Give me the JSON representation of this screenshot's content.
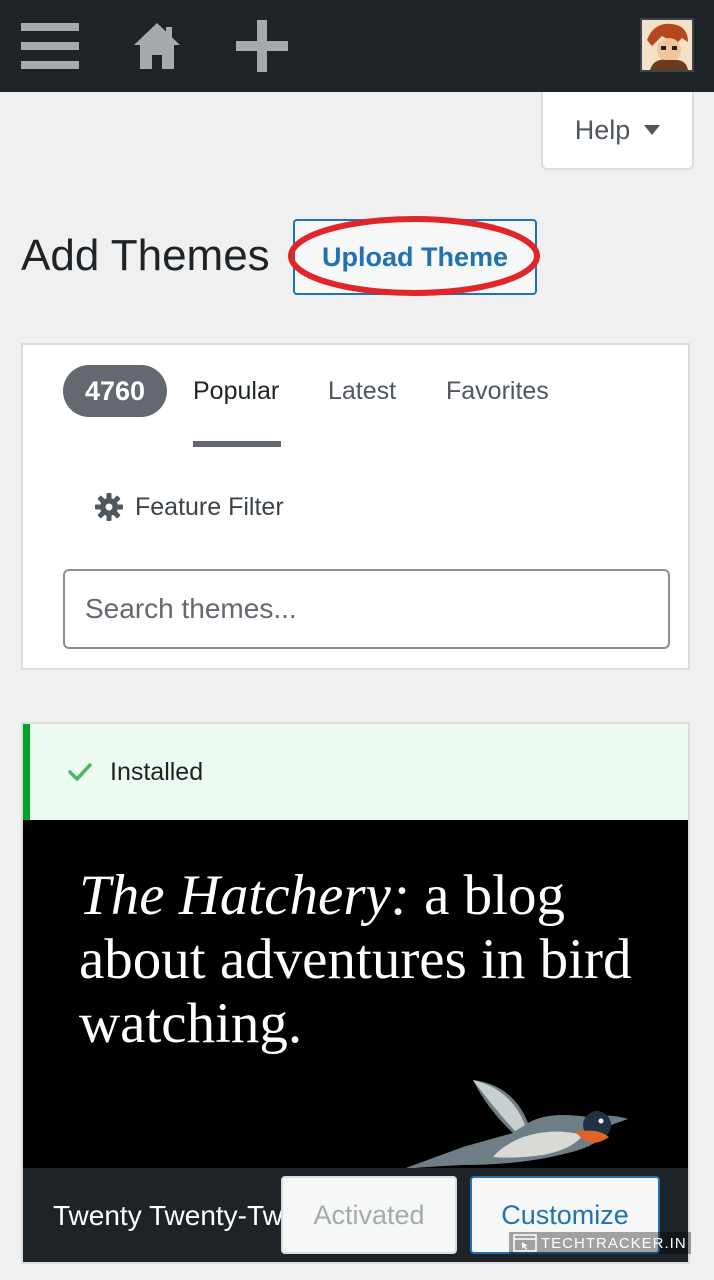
{
  "admin_bar": {
    "icons": [
      "menu-icon",
      "home-icon",
      "plus-icon"
    ],
    "bg_color": "#1d2327"
  },
  "help": {
    "label": "Help"
  },
  "heading": {
    "title": "Add Themes",
    "upload_button": "Upload Theme",
    "highlight_color": "#e0262b"
  },
  "filter": {
    "count": "4760",
    "tabs": [
      "Popular",
      "Latest",
      "Favorites"
    ],
    "active_tab": "Popular",
    "feature_filter": "Feature Filter",
    "search_placeholder": "Search themes..."
  },
  "theme_card": {
    "installed_label": "Installed",
    "preview": {
      "title_italic": "The Hatchery:",
      "title_rest": " a blog about adventures in bird watching."
    },
    "name": "Twenty Twenty-Two",
    "activated_label": "Activated",
    "customize_label": "Customize"
  },
  "watermark": {
    "text": "TECHTRACKER.IN"
  },
  "colors": {
    "accent": "#2271b1",
    "success": "#00a32a"
  }
}
